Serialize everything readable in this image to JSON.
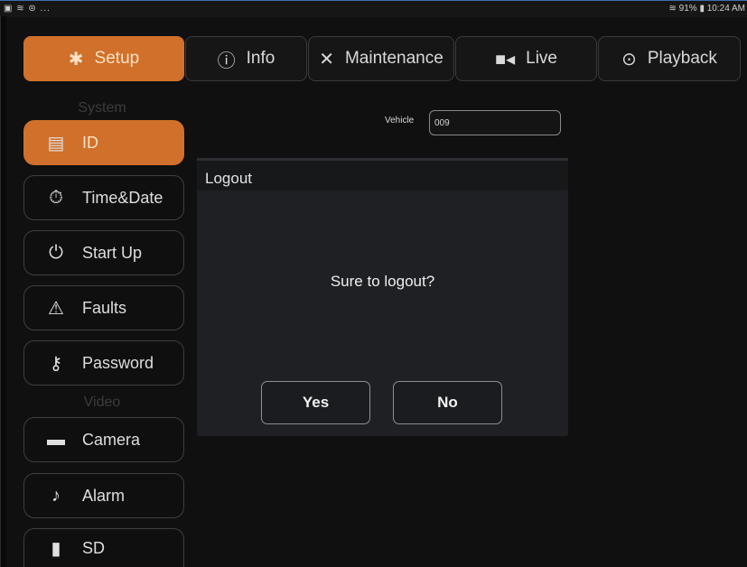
{
  "status_bar": {
    "left_icons": "▣ ≋ ⊜ ...",
    "right_text": "≋ 91% ▮ 10:24 AM"
  },
  "tabs": [
    {
      "label": "Setup",
      "icon": "gear-icon",
      "active": true
    },
    {
      "label": "Info",
      "icon": "info-circle-icon",
      "active": false
    },
    {
      "label": "Maintenance",
      "icon": "tools-icon",
      "active": false
    },
    {
      "label": "Live",
      "icon": "video-camera-icon",
      "active": false
    },
    {
      "label": "Playback",
      "icon": "playback-icon",
      "active": false
    }
  ],
  "sidebar": {
    "system_label": "System",
    "video_label": "Video",
    "items": [
      {
        "label": "ID",
        "icon": "id-card-icon",
        "active": true
      },
      {
        "label": "Time&Date",
        "icon": "stopwatch-icon",
        "active": false
      },
      {
        "label": "Start Up",
        "icon": "power-icon",
        "active": false
      },
      {
        "label": "Faults",
        "icon": "warning-icon",
        "active": false
      },
      {
        "label": "Password",
        "icon": "key-icon",
        "active": false
      },
      {
        "label": "Camera",
        "icon": "cctv-camera-icon",
        "active": false
      },
      {
        "label": "Alarm",
        "icon": "bell-icon",
        "active": false
      },
      {
        "label": "SD",
        "icon": "sd-card-icon",
        "active": false
      }
    ]
  },
  "form": {
    "vehicle_label": "Vehicle",
    "vehicle_value": "009"
  },
  "dialog": {
    "title": "Logout",
    "message": "Sure to logout?",
    "yes_label": "Yes",
    "no_label": "No"
  },
  "colors": {
    "accent": "#d0702a",
    "background": "#101011",
    "dialog_bg": "#1e2023"
  }
}
